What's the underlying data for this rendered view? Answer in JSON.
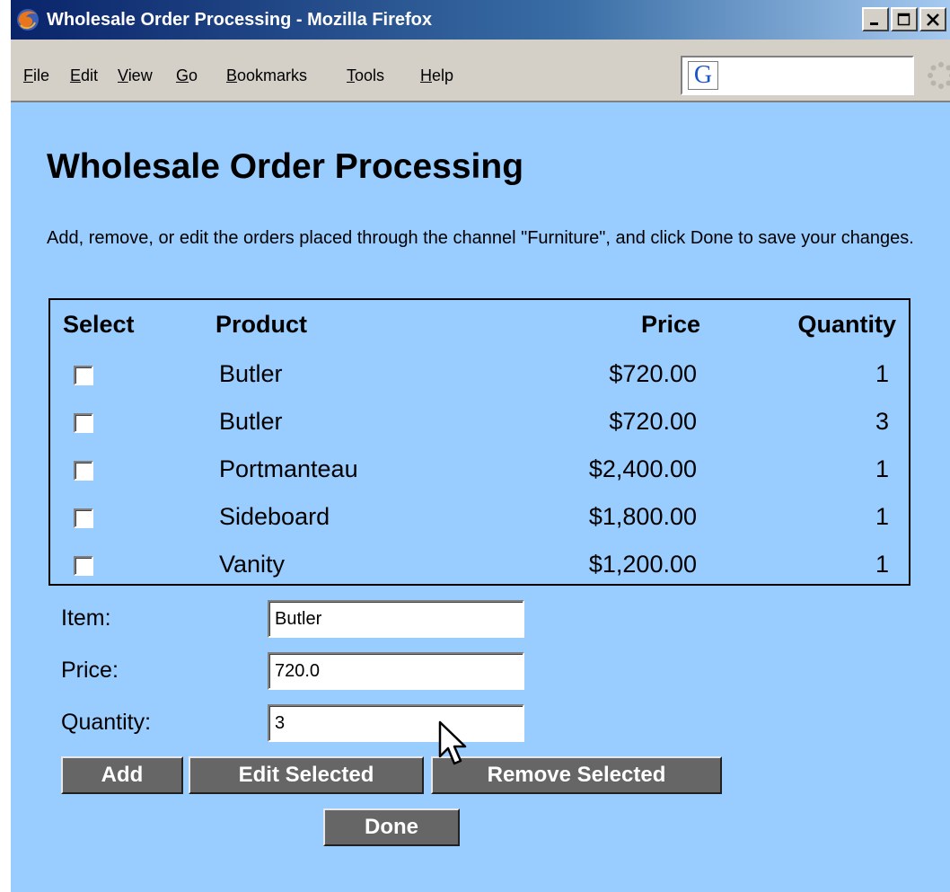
{
  "window": {
    "title": "Wholesale Order Processing - Mozilla Firefox",
    "controls": {
      "minimize": "_",
      "maximize": "□",
      "close": "X"
    }
  },
  "menu": {
    "items": [
      {
        "accel": "F",
        "rest": "ile"
      },
      {
        "accel": "E",
        "rest": "dit"
      },
      {
        "accel": "V",
        "rest": "iew"
      },
      {
        "accel": "G",
        "rest": "o"
      },
      {
        "accel": "B",
        "rest": "ookmarks"
      },
      {
        "accel": "T",
        "rest": "ools"
      },
      {
        "accel": "H",
        "rest": "elp"
      }
    ],
    "search_engine_glyph": "G",
    "search_value": ""
  },
  "page": {
    "title": "Wholesale Order Processing",
    "instructions": "Add, remove, or edit the orders placed through the channel \"Furniture\", and click Done to save your changes."
  },
  "table": {
    "headers": {
      "select": "Select",
      "product": "Product",
      "price": "Price",
      "quantity": "Quantity"
    },
    "rows": [
      {
        "product": "Butler",
        "price": "$720.00",
        "quantity": "1",
        "selected": false
      },
      {
        "product": "Butler",
        "price": "$720.00",
        "quantity": "3",
        "selected": false
      },
      {
        "product": "Portmanteau",
        "price": "$2,400.00",
        "quantity": "1",
        "selected": false
      },
      {
        "product": "Sideboard",
        "price": "$1,800.00",
        "quantity": "1",
        "selected": false
      },
      {
        "product": "Vanity",
        "price": "$1,200.00",
        "quantity": "1",
        "selected": false
      }
    ]
  },
  "form": {
    "item_label": "Item:",
    "item_value": "Butler",
    "price_label": "Price:",
    "price_value": "720.0",
    "quantity_label": "Quantity:",
    "quantity_value": "3"
  },
  "buttons": {
    "add": "Add",
    "edit_selected": "Edit Selected",
    "remove_selected": "Remove Selected",
    "done": "Done"
  },
  "colors": {
    "page_background": "#99ccff",
    "button_background": "#666666",
    "title_bar": "#0a246a"
  },
  "icons": {
    "app": "firefox-icon",
    "throbber": "throbber-icon",
    "cursor": "mouse-pointer-icon"
  }
}
